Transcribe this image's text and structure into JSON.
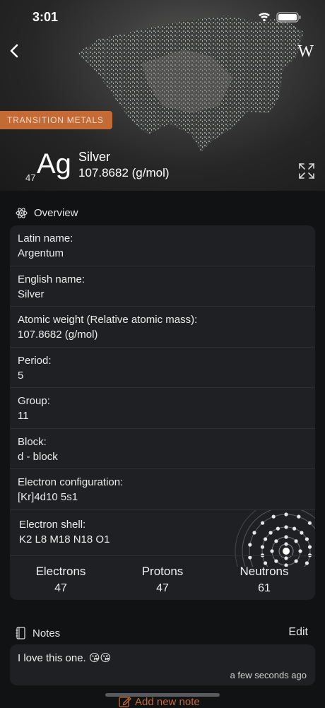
{
  "status_bar": {
    "time": "3:01"
  },
  "header": {
    "category": "TRANSITION METALS",
    "atomic_number": "47",
    "symbol": "Ag",
    "name": "Silver",
    "weight": "107.8682 (g/mol)",
    "wiki_label": "W"
  },
  "overview": {
    "title": "Overview",
    "rows": [
      {
        "label": "Latin name:",
        "value": "Argentum"
      },
      {
        "label": "English name:",
        "value": "Silver"
      },
      {
        "label": "Atomic weight (Relative atomic mass):",
        "value": "107.8682 (g/mol)"
      },
      {
        "label": "Period:",
        "value": "5"
      },
      {
        "label": "Group:",
        "value": "11"
      },
      {
        "label": "Block:",
        "value": "d - block"
      },
      {
        "label": "Electron configuration:",
        "value": "[Kr]4d10 5s1"
      },
      {
        "label": "Electron shell:",
        "value": "K2 L8 M18 N18 O1"
      }
    ],
    "counts": [
      {
        "label": "Electrons",
        "value": "47"
      },
      {
        "label": "Protons",
        "value": "47"
      },
      {
        "label": "Neutrons",
        "value": "61"
      }
    ]
  },
  "notes": {
    "title": "Notes",
    "edit_label": "Edit",
    "items": [
      {
        "text": "I love this one. 😘😘",
        "time": "a few seconds ago"
      }
    ],
    "add_label": "Add new note"
  },
  "colors": {
    "accent": "#c36a35",
    "card": "#1f2023",
    "background": "#111214"
  }
}
